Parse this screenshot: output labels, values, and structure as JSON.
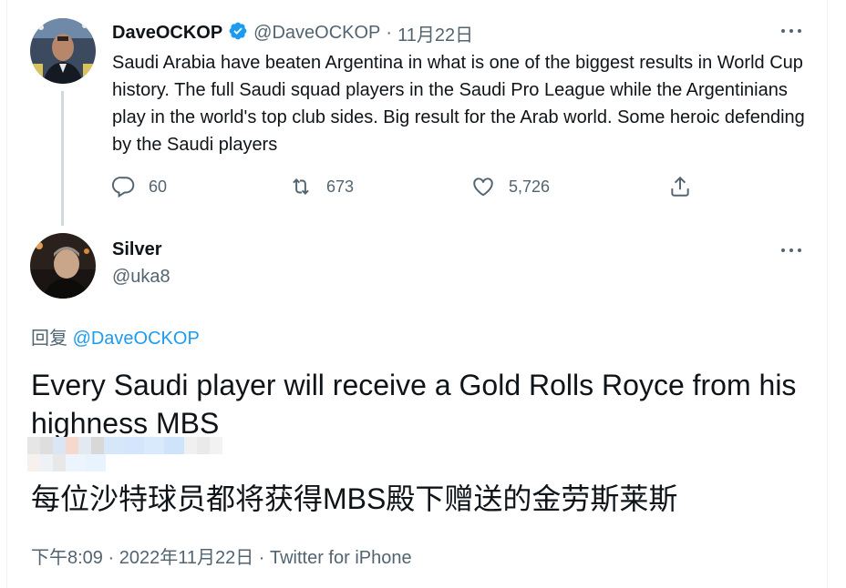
{
  "colors": {
    "accent": "#1d9bf0",
    "muted": "#536471",
    "text": "#0f1419",
    "thread_line": "#cfd9de"
  },
  "first_tweet": {
    "display_name": "DaveOCKOP",
    "verified_icon": "verified-badge-icon",
    "handle": "@DaveOCKOP",
    "separator": "·",
    "date": "11月22日",
    "text": "Saudi Arabia have beaten Argentina in what is one of the biggest results in World Cup history. The full Saudi squad players in the Saudi Pro League while the Argentinians play in the world's top club sides. Big result for the Arab world. Some heroic defending by the Saudi players",
    "actions": {
      "reply_icon": "reply-icon",
      "reply_count": "60",
      "retweet_icon": "retweet-icon",
      "retweet_count": "673",
      "like_icon": "heart-icon",
      "like_count": "5,726",
      "share_icon": "share-icon"
    }
  },
  "main_tweet": {
    "display_name": "Silver",
    "handle": "@uka8",
    "reply_prefix": "回复",
    "reply_to": "@DaveOCKOP",
    "text": "Every Saudi player will receive a Gold Rolls Royce from his highness MBS",
    "translation": "每位沙特球员都将获得MBS殿下赠送的金劳斯莱斯",
    "meta": "下午8:09 · 2022年11月22日 · Twitter for iPhone"
  }
}
